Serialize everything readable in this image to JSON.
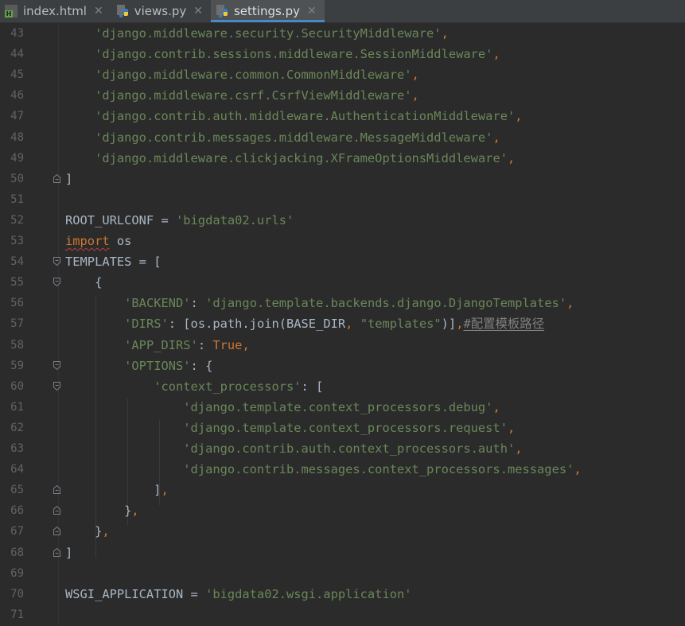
{
  "tabs": [
    {
      "label": "index.html",
      "icon": "html-file-icon",
      "active": false
    },
    {
      "label": "views.py",
      "icon": "python-file-icon",
      "active": false
    },
    {
      "label": "settings.py",
      "icon": "python-file-icon",
      "active": true
    }
  ],
  "colors": {
    "background": "#2b2b2b",
    "default_text": "#a9b7c6",
    "string": "#6a8759",
    "keyword": "#cc7832",
    "comment": "#808080",
    "line_number": "#606366",
    "active_tab_underline": "#4a88c7"
  },
  "lines": [
    {
      "n": "43",
      "fold": "",
      "tokens": [
        {
          "t": "    "
        },
        {
          "t": "'django.middleware.security.SecurityMiddleware'",
          "c": "str"
        },
        {
          "t": ",",
          "c": "kw"
        }
      ]
    },
    {
      "n": "44",
      "fold": "",
      "tokens": [
        {
          "t": "    "
        },
        {
          "t": "'django.contrib.sessions.middleware.SessionMiddleware'",
          "c": "str"
        },
        {
          "t": ",",
          "c": "kw"
        }
      ]
    },
    {
      "n": "45",
      "fold": "",
      "tokens": [
        {
          "t": "    "
        },
        {
          "t": "'django.middleware.common.CommonMiddleware'",
          "c": "str"
        },
        {
          "t": ",",
          "c": "kw"
        }
      ]
    },
    {
      "n": "46",
      "fold": "",
      "tokens": [
        {
          "t": "    "
        },
        {
          "t": "'django.middleware.csrf.CsrfViewMiddleware'",
          "c": "str"
        },
        {
          "t": ",",
          "c": "kw"
        }
      ]
    },
    {
      "n": "47",
      "fold": "",
      "tokens": [
        {
          "t": "    "
        },
        {
          "t": "'django.contrib.auth.middleware.AuthenticationMiddleware'",
          "c": "str"
        },
        {
          "t": ",",
          "c": "kw"
        }
      ]
    },
    {
      "n": "48",
      "fold": "",
      "tokens": [
        {
          "t": "    "
        },
        {
          "t": "'django.contrib.messages.middleware.MessageMiddleware'",
          "c": "str"
        },
        {
          "t": ",",
          "c": "kw"
        }
      ]
    },
    {
      "n": "49",
      "fold": "",
      "tokens": [
        {
          "t": "    "
        },
        {
          "t": "'django.middleware.clickjacking.XFrameOptionsMiddleware'",
          "c": "str"
        },
        {
          "t": ",",
          "c": "kw"
        }
      ]
    },
    {
      "n": "50",
      "fold": "end",
      "tokens": [
        {
          "t": "]"
        }
      ]
    },
    {
      "n": "51",
      "fold": "",
      "tokens": []
    },
    {
      "n": "52",
      "fold": "",
      "tokens": [
        {
          "t": "ROOT_URLCONF = "
        },
        {
          "t": "'bigdata02.urls'",
          "c": "str"
        }
      ]
    },
    {
      "n": "53",
      "fold": "",
      "tokens": [
        {
          "t": "import",
          "c": "kw squig"
        },
        {
          "t": " os"
        }
      ]
    },
    {
      "n": "54",
      "fold": "start",
      "tokens": [
        {
          "t": "TEMPLATES = ["
        }
      ]
    },
    {
      "n": "55",
      "fold": "start",
      "tokens": [
        {
          "t": "    {"
        }
      ]
    },
    {
      "n": "56",
      "fold": "",
      "tokens": [
        {
          "t": "        "
        },
        {
          "t": "'BACKEND'",
          "c": "str"
        },
        {
          "t": ": "
        },
        {
          "t": "'django.template.backends.django.DjangoTemplates'",
          "c": "str"
        },
        {
          "t": ",",
          "c": "kw"
        }
      ]
    },
    {
      "n": "57",
      "fold": "",
      "tokens": [
        {
          "t": "        "
        },
        {
          "t": "'DIRS'",
          "c": "str"
        },
        {
          "t": ": [os.path.join(BASE_DIR"
        },
        {
          "t": ",",
          "c": "kw"
        },
        {
          "t": " "
        },
        {
          "t": "\"templates\"",
          "c": "str"
        },
        {
          "t": ")]"
        },
        {
          "t": ",",
          "c": "kw"
        },
        {
          "t": "#配置模板路径",
          "c": "cmt uline"
        }
      ]
    },
    {
      "n": "58",
      "fold": "",
      "tokens": [
        {
          "t": "        "
        },
        {
          "t": "'APP_DIRS'",
          "c": "str"
        },
        {
          "t": ": "
        },
        {
          "t": "True",
          "c": "kw"
        },
        {
          "t": ",",
          "c": "kw"
        }
      ]
    },
    {
      "n": "59",
      "fold": "start",
      "tokens": [
        {
          "t": "        "
        },
        {
          "t": "'OPTIONS'",
          "c": "str"
        },
        {
          "t": ": {"
        }
      ]
    },
    {
      "n": "60",
      "fold": "start",
      "tokens": [
        {
          "t": "            "
        },
        {
          "t": "'context_processors'",
          "c": "str"
        },
        {
          "t": ": ["
        }
      ]
    },
    {
      "n": "61",
      "fold": "",
      "tokens": [
        {
          "t": "                "
        },
        {
          "t": "'django.template.context_processors.debug'",
          "c": "str"
        },
        {
          "t": ",",
          "c": "kw"
        }
      ]
    },
    {
      "n": "62",
      "fold": "",
      "tokens": [
        {
          "t": "                "
        },
        {
          "t": "'django.template.context_processors.request'",
          "c": "str"
        },
        {
          "t": ",",
          "c": "kw"
        }
      ]
    },
    {
      "n": "63",
      "fold": "",
      "tokens": [
        {
          "t": "                "
        },
        {
          "t": "'django.contrib.auth.context_processors.auth'",
          "c": "str"
        },
        {
          "t": ",",
          "c": "kw"
        }
      ]
    },
    {
      "n": "64",
      "fold": "",
      "tokens": [
        {
          "t": "                "
        },
        {
          "t": "'django.contrib.messages.context_processors.messages'",
          "c": "str"
        },
        {
          "t": ",",
          "c": "kw"
        }
      ]
    },
    {
      "n": "65",
      "fold": "end",
      "tokens": [
        {
          "t": "            ]"
        },
        {
          "t": ",",
          "c": "kw"
        }
      ]
    },
    {
      "n": "66",
      "fold": "end",
      "tokens": [
        {
          "t": "        }"
        },
        {
          "t": ",",
          "c": "kw"
        }
      ]
    },
    {
      "n": "67",
      "fold": "end",
      "tokens": [
        {
          "t": "    }"
        },
        {
          "t": ",",
          "c": "kw"
        }
      ]
    },
    {
      "n": "68",
      "fold": "end",
      "tokens": [
        {
          "t": "]"
        }
      ]
    },
    {
      "n": "69",
      "fold": "",
      "tokens": []
    },
    {
      "n": "70",
      "fold": "",
      "tokens": [
        {
          "t": "WSGI_APPLICATION = "
        },
        {
          "t": "'bigdata02.wsgi.application'",
          "c": "str"
        }
      ]
    },
    {
      "n": "71",
      "fold": "",
      "tokens": []
    }
  ]
}
